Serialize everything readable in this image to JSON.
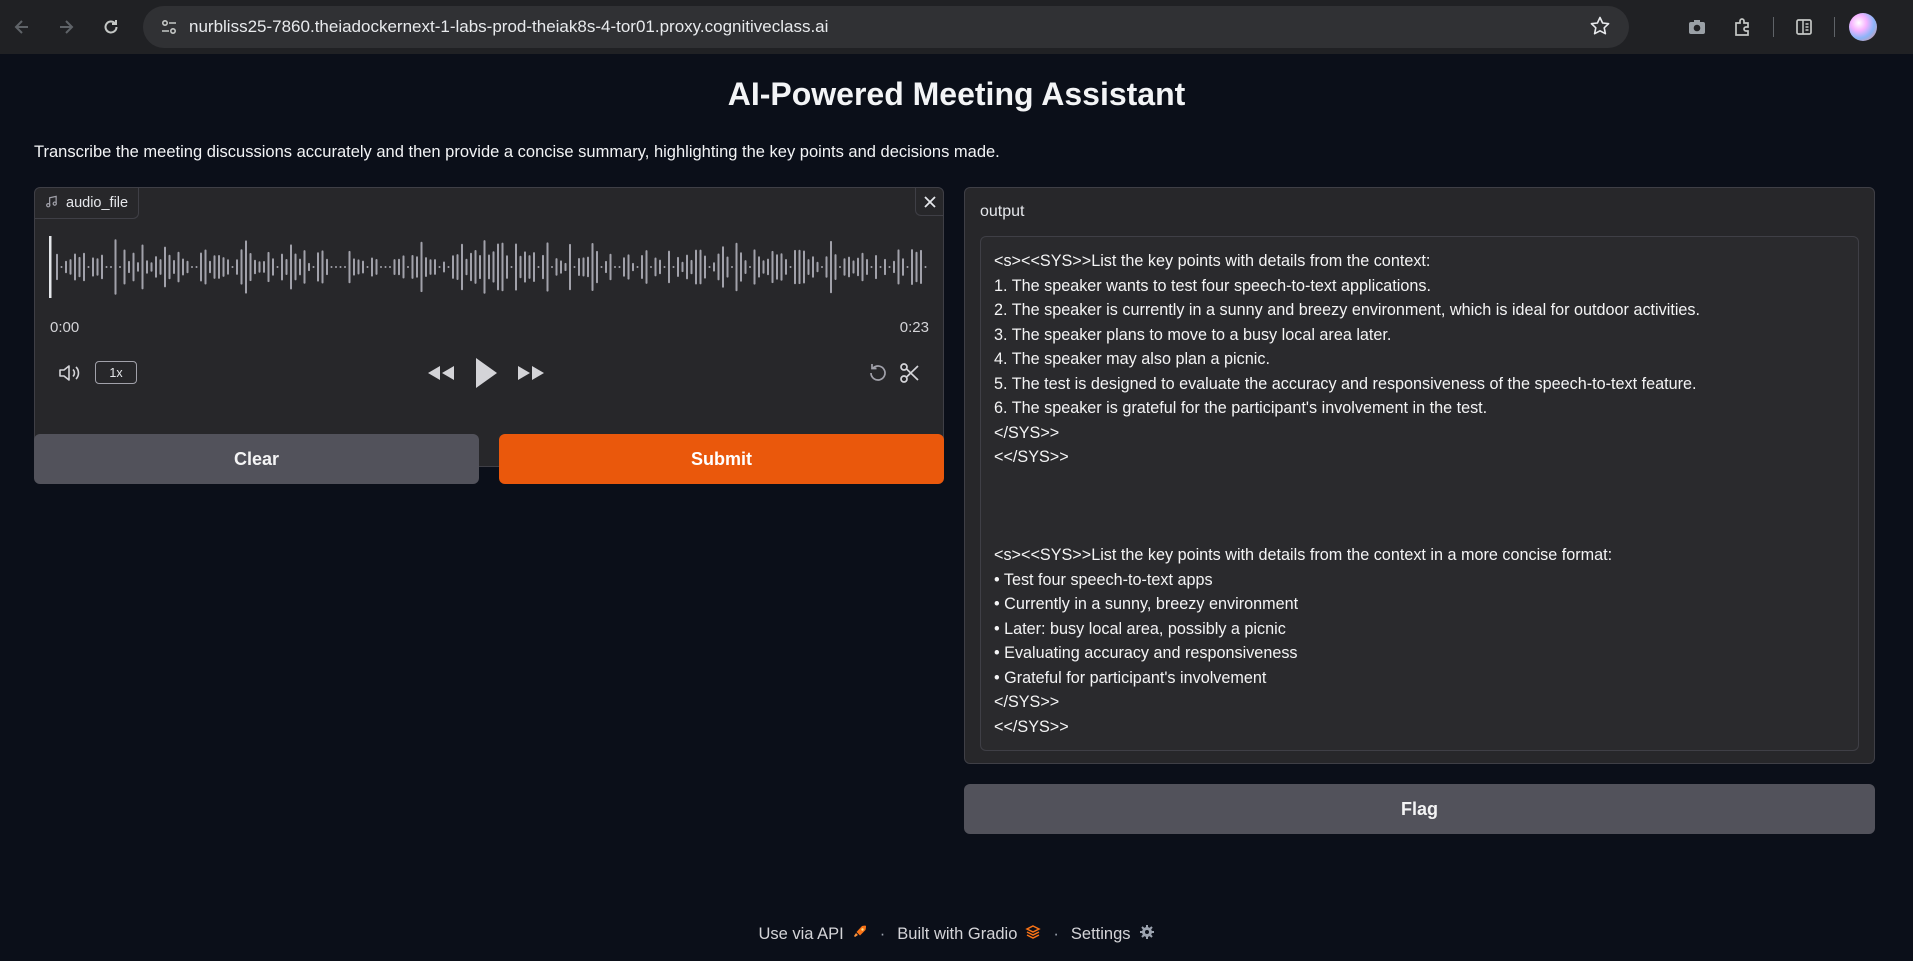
{
  "browser": {
    "url": "nurbliss25-7860.theiadockernext-1-labs-prod-theiak8s-4-tor01.proxy.cognitiveclass.ai",
    "icons": [
      "back-icon",
      "forward-icon",
      "reload-icon",
      "site-info-icon",
      "bookmark-star-icon",
      "camera-icon",
      "extensions-icon",
      "sidebar-icon",
      "profile-avatar"
    ]
  },
  "header": {
    "title": "AI-Powered Meeting Assistant",
    "description": "Transcribe the meeting discussions accurately and then provide a concise summary, highlighting the key points and decisions made."
  },
  "audio": {
    "label": "audio_file",
    "time_current": "0:00",
    "time_total": "0:23",
    "speed": "1x",
    "icons": [
      "music-note-icon",
      "close-icon",
      "volume-icon",
      "rewind-icon",
      "play-icon",
      "fast-forward-icon",
      "reset-icon",
      "trim-icon"
    ]
  },
  "buttons": {
    "clear": "Clear",
    "submit": "Submit",
    "flag": "Flag"
  },
  "output": {
    "label": "output",
    "lines": [
      "<s><<SYS>>List the key points with details from the context:",
      "1. The speaker wants to test four speech-to-text applications.",
      "2. The speaker is currently in a sunny and breezy environment, which is ideal for outdoor activities.",
      "3. The speaker plans to move to a busy local area later.",
      "4. The speaker may also plan a picnic.",
      "5. The test is designed to evaluate the accuracy and responsiveness of the speech-to-text feature.",
      "6. The speaker is grateful for the participant's involvement in the test.",
      "</SYS>>",
      "<</SYS>>",
      "",
      "",
      "",
      "<s><<SYS>>List the key points with details from the context in a more concise format:",
      "• Test four speech-to-text apps",
      "• Currently in a sunny, breezy environment",
      "• Later: busy local area, possibly a picnic",
      "• Evaluating accuracy and responsiveness",
      "• Grateful for participant's involvement",
      "</SYS>>",
      "<</SYS>>"
    ]
  },
  "footer": {
    "api": "Use via API",
    "built": "Built with Gradio",
    "settings": "Settings",
    "separator": "·"
  },
  "colors": {
    "accent": "#ea580c",
    "background": "#0b0f19",
    "panel": "#27272a"
  }
}
